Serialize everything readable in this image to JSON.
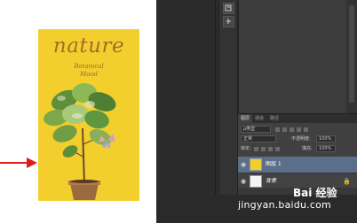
{
  "poster": {
    "title": "nature",
    "subtitle_line1": "Botanical",
    "subtitle_line2": "Mood"
  },
  "layers_panel": {
    "tabs": [
      "图层",
      "通道",
      "路径"
    ],
    "filter_kind": "ρ类型",
    "blend_mode": "正常",
    "opacity_label": "不透明度:",
    "opacity_value": "100%",
    "lock_label": "锁定:",
    "fill_label": "填充:",
    "fill_value": "100%",
    "layers": [
      {
        "name": "图层 1",
        "selected": true
      },
      {
        "name": "背景",
        "selected": false
      }
    ]
  },
  "watermark": {
    "logo": "Bai 经验",
    "url": "jingyan.baidu.com"
  },
  "colors": {
    "poster_bg": "#f3cf2d",
    "arrow": "#e01b1b",
    "selected_layer": "#5c6f8a"
  }
}
